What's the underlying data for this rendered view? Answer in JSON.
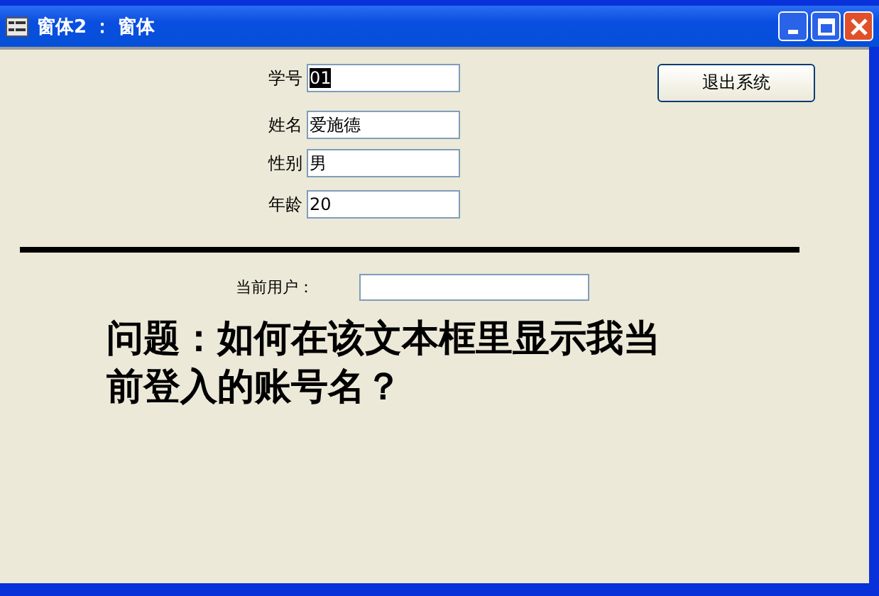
{
  "window": {
    "title": "窗体2 ： 窗体"
  },
  "fields": [
    {
      "label": "学号",
      "value": "01",
      "text_selected": true
    },
    {
      "label": "姓名",
      "value": "爱施德",
      "text_selected": false
    },
    {
      "label": "性别",
      "value": "男",
      "text_selected": false
    },
    {
      "label": "年龄",
      "value": "20",
      "text_selected": false
    }
  ],
  "exit_button": "退出系统",
  "current_user": {
    "label": "当前用户："
  },
  "question": "问题：如何在该文本框里显示我当前登入的账号名？"
}
